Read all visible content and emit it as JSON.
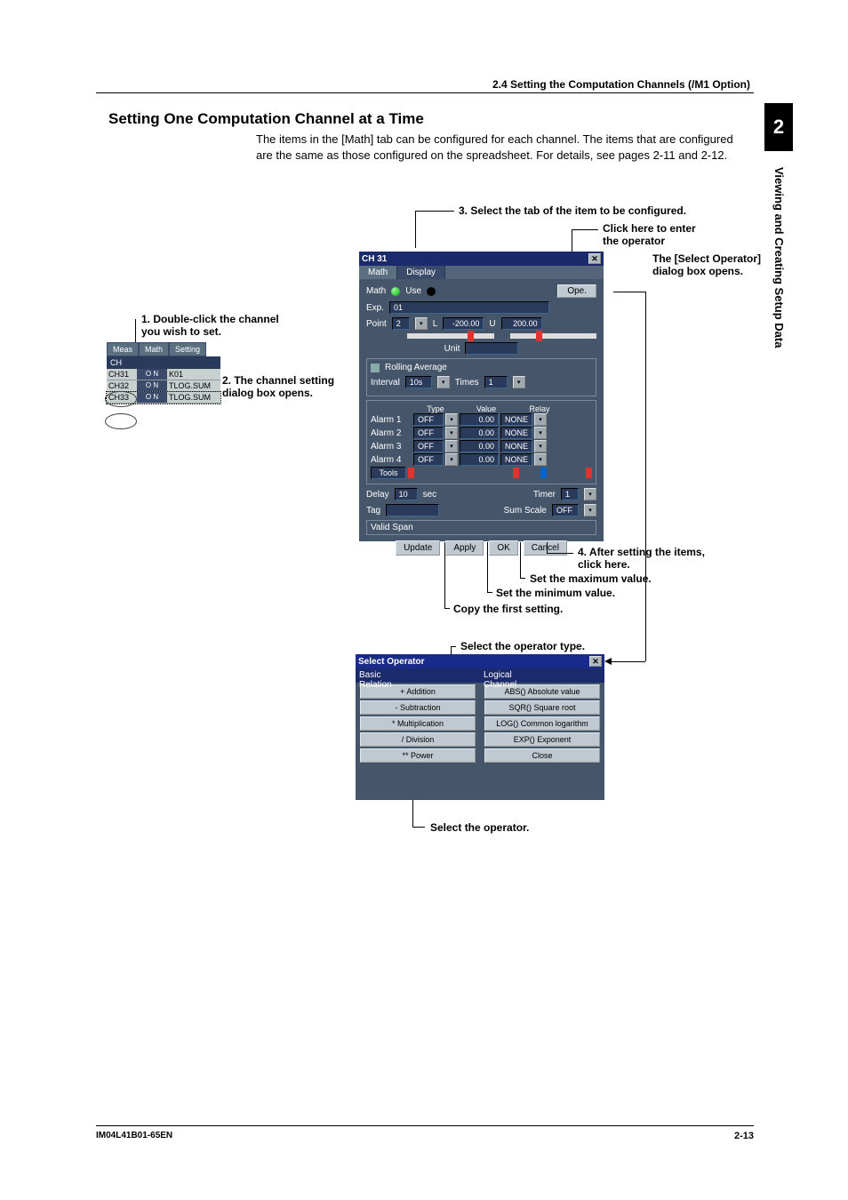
{
  "header": {
    "section": "2.4  Setting the Computation Channels (/M1 Option)"
  },
  "headings": {
    "h2": "Setting One Computation Channel at a Time",
    "intro": "The items in the [Math] tab can be configured for each channel. The items that are configured are the same as those configured on the spreadsheet. For details, see pages 2-11 and 2-12."
  },
  "sidebar": {
    "chapter": "2",
    "title": "Viewing and Creating Setup Data"
  },
  "annotations": {
    "a1_l1": "1. Double-click the channel",
    "a1_l2": "    you wish to set.",
    "a2_l1": "2. The channel setting",
    "a2_l2": "    dialog box opens.",
    "a3": "3. Select the tab of the item to be configured.",
    "a_click_l1": "Click here to enter",
    "a_click_l2": "the operator",
    "a_selop_l1": "The [Select Operator]",
    "a_selop_l2": "dialog box opens.",
    "a4_l1": "4. After setting the items,",
    "a4_l2": "    click here.",
    "a_max": "Set the maximum value.",
    "a_min": "Set the minimum value.",
    "a_copy": "Copy the first setting.",
    "a_optype": "Select the operator type.",
    "a_op": "Select the operator."
  },
  "channel_table": {
    "tabs": [
      "Meas",
      "Math",
      "Setting"
    ],
    "hdr": "CH",
    "rows": [
      {
        "ch": "CH31",
        "flag": "O N",
        "exp": "K01"
      },
      {
        "ch": "CH32",
        "flag": "O N",
        "exp": "TLOG.SUM"
      },
      {
        "ch": "CH33",
        "flag": "O N",
        "exp": "TLOG.SUM"
      }
    ]
  },
  "dialog": {
    "title": "CH 31",
    "tabs": [
      "Math",
      "Display"
    ],
    "math": {
      "lbl": "Math",
      "use": "Use"
    },
    "ope": "Ope.",
    "exp": {
      "lbl": "Exp.",
      "val": "01"
    },
    "point": {
      "lbl": "Point",
      "val": "2",
      "L": "L",
      "lval": "-200.00",
      "U": "U",
      "uval": "200.00",
      "unit": "Unit"
    },
    "rolling": {
      "title": "Rolling Average",
      "interval": "Interval",
      "ival": "10s",
      "times": "Times",
      "tval": "1"
    },
    "alarms": {
      "hdr": {
        "type": "Type",
        "value": "Value",
        "relay": "Relay"
      },
      "rows": [
        {
          "name": "Alarm 1",
          "type": "OFF",
          "value": "0.00",
          "relay": "NONE"
        },
        {
          "name": "Alarm 2",
          "type": "OFF",
          "value": "0.00",
          "relay": "NONE"
        },
        {
          "name": "Alarm 3",
          "type": "OFF",
          "value": "0.00",
          "relay": "NONE"
        },
        {
          "name": "Alarm 4",
          "type": "OFF",
          "value": "0.00",
          "relay": "NONE"
        }
      ],
      "tools": "Tools"
    },
    "delay": {
      "lbl": "Delay",
      "val": "10",
      "sec": "sec",
      "timer": "Timer",
      "tval": "1"
    },
    "tag": {
      "lbl": "Tag",
      "sumscale": "Sum Scale",
      "sval": "OFF"
    },
    "validspan": "Valid Span",
    "buttons": {
      "update": "Update",
      "apply": "Apply",
      "ok": "OK",
      "cancel": "Cancel"
    }
  },
  "select_operator": {
    "title": "Select Operator",
    "left_hdr": "Basic\nRelation",
    "right_hdr": "Logical\nChannel",
    "left": [
      "+ Addition",
      "- Subtraction",
      "* Multiplication",
      "/ Division",
      "** Power"
    ],
    "right": [
      "ABS() Absolute value",
      "SQR() Square root",
      "LOG() Common logarithm",
      "EXP() Exponent",
      "Close"
    ]
  },
  "footer": {
    "left": "IM04L41B01-65EN",
    "right": "2-13"
  }
}
